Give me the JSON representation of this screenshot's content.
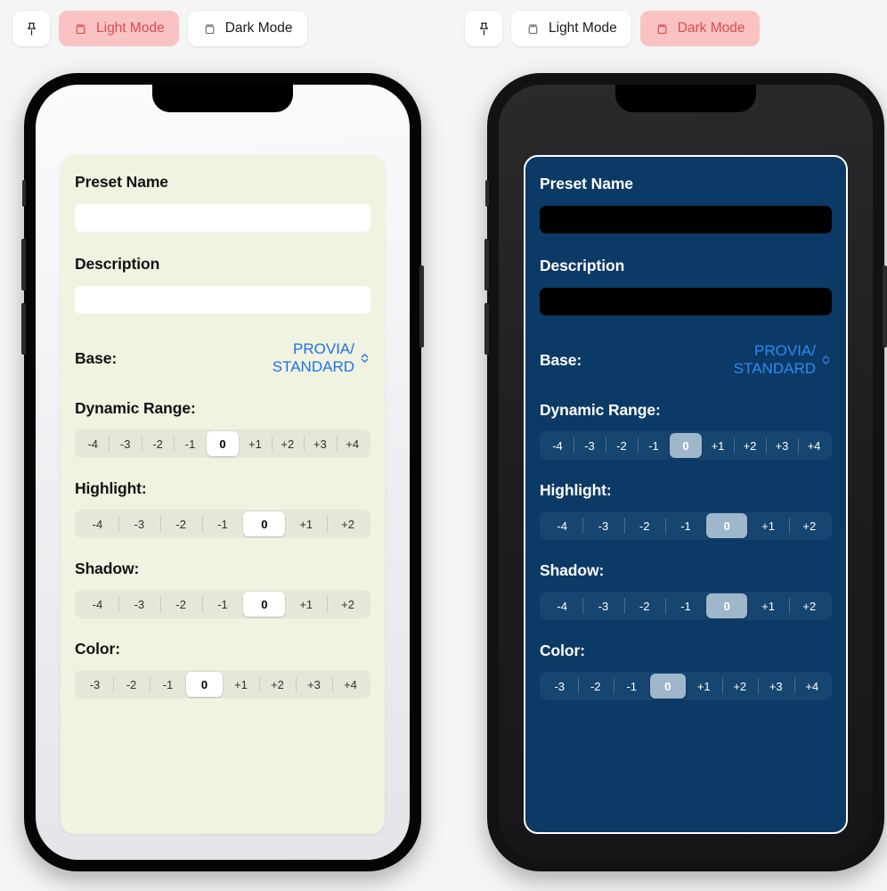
{
  "theme": {
    "accent_red": "#e0494f",
    "accent_red_bg": "#f9c3c3",
    "light_card_bg": "#f1f3e1",
    "dark_card_bg": "#0c3a66",
    "light_link_blue": "#1b72e8",
    "dark_link_blue": "#2b8bf2",
    "dark_seg_selected": "#9fb7cb"
  },
  "toolbars": [
    {
      "id": "light-toolbar",
      "pin_icon": "pin-icon",
      "buttons": [
        {
          "label": "Light Mode",
          "icon": "device-box-icon",
          "active": true
        },
        {
          "label": "Dark Mode",
          "icon": "device-box-icon",
          "active": false
        }
      ]
    },
    {
      "id": "dark-toolbar",
      "pin_icon": "pin-icon",
      "buttons": [
        {
          "label": "Light Mode",
          "icon": "device-box-icon",
          "active": false
        },
        {
          "label": "Dark Mode",
          "icon": "device-box-icon",
          "active": true
        }
      ]
    }
  ],
  "form": {
    "preset_name_label": "Preset Name",
    "preset_name_value": "",
    "preset_name_placeholder": "",
    "description_label": "Description",
    "description_value": "",
    "description_placeholder": "",
    "base_label": "Base:",
    "base_value": "PROVIA/ STANDARD",
    "base_stepper_icon": "chevron-up-down-icon",
    "sections": [
      {
        "label": "Dynamic Range:",
        "options": [
          "-4",
          "-3",
          "-2",
          "-1",
          "0",
          "+1",
          "+2",
          "+3",
          "+4"
        ],
        "selected_index": 4,
        "selected_value": "0"
      },
      {
        "label": "Highlight:",
        "options": [
          "-4",
          "-3",
          "-2",
          "-1",
          "0",
          "+1",
          "+2"
        ],
        "selected_index": 4,
        "selected_value": "0"
      },
      {
        "label": "Shadow:",
        "options": [
          "-4",
          "-3",
          "-2",
          "-1",
          "0",
          "+1",
          "+2"
        ],
        "selected_index": 4,
        "selected_value": "0"
      },
      {
        "label": "Color:",
        "options": [
          "-3",
          "-2",
          "-1",
          "0",
          "+1",
          "+2",
          "+3",
          "+4"
        ],
        "selected_index": 3,
        "selected_value": "0"
      }
    ]
  }
}
